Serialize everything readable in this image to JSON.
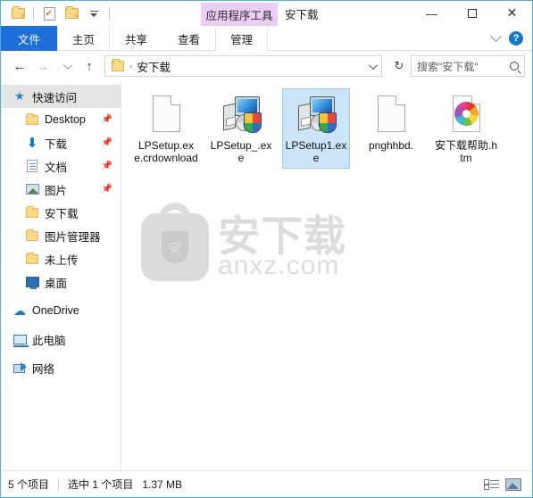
{
  "window": {
    "title": "安下载",
    "apptools_tab": "应用程序工具",
    "minimize": "—",
    "maximize": "",
    "close": "✕"
  },
  "quick_access_toolbar": {
    "items": [
      {
        "name": "folder-icon",
        "label": ""
      },
      {
        "name": "properties-icon",
        "label": ""
      },
      {
        "name": "new-folder-icon",
        "label": ""
      },
      {
        "name": "customize-dropdown-icon",
        "label": ""
      }
    ]
  },
  "ribbon": {
    "tabs": [
      {
        "label": "文件",
        "selected": true
      },
      {
        "label": "主页",
        "selected": false
      },
      {
        "label": "共享",
        "selected": false
      },
      {
        "label": "查看",
        "selected": false
      },
      {
        "label": "管理",
        "selected": false
      }
    ],
    "minimize_ribbon": "",
    "help": "?"
  },
  "address_bar": {
    "back": "←",
    "forward": "→",
    "recent": "",
    "up": "↑",
    "breadcrumb": [
      {
        "label": "安下载"
      }
    ],
    "separator": "›",
    "refresh": "↻",
    "search": {
      "placeholder": "搜索\"安下载\"",
      "value": ""
    }
  },
  "sidebar": {
    "items": [
      {
        "label": "快速访问",
        "icon": "star-icon",
        "selected": true,
        "indent": 0,
        "pinned": false
      },
      {
        "label": "Desktop",
        "icon": "folder-icon",
        "selected": false,
        "indent": 1,
        "pinned": true
      },
      {
        "label": "下载",
        "icon": "download-icon",
        "selected": false,
        "indent": 1,
        "pinned": true
      },
      {
        "label": "文档",
        "icon": "document-icon",
        "selected": false,
        "indent": 1,
        "pinned": true
      },
      {
        "label": "图片",
        "icon": "picture-icon",
        "selected": false,
        "indent": 1,
        "pinned": true
      },
      {
        "label": "安下载",
        "icon": "folder-icon",
        "selected": false,
        "indent": 1,
        "pinned": false
      },
      {
        "label": "图片管理器",
        "icon": "folder-icon",
        "selected": false,
        "indent": 1,
        "pinned": false
      },
      {
        "label": "未上传",
        "icon": "folder-icon",
        "selected": false,
        "indent": 1,
        "pinned": false
      },
      {
        "label": "桌面",
        "icon": "desktop-icon",
        "selected": false,
        "indent": 1,
        "pinned": false
      },
      {
        "label": "OneDrive",
        "icon": "onedrive-icon",
        "selected": false,
        "indent": 0,
        "pinned": false
      },
      {
        "label": "此电脑",
        "icon": "this-pc-icon",
        "selected": false,
        "indent": 0,
        "pinned": false
      },
      {
        "label": "网络",
        "icon": "network-icon",
        "selected": false,
        "indent": 0,
        "pinned": false
      }
    ],
    "pin_glyph": "📌"
  },
  "files": [
    {
      "name": "LPSetup.exe.crdownload",
      "icon": "blank-file-icon",
      "selected": false
    },
    {
      "name": "LPSetup_.exe",
      "icon": "setup-exe-icon",
      "selected": false
    },
    {
      "name": "LPSetup1.exe",
      "icon": "setup-exe-icon",
      "selected": true
    },
    {
      "name": "pnghhbd.",
      "icon": "blank-file-icon",
      "selected": false
    },
    {
      "name": "安下载帮助.htm",
      "icon": "html-pinwheel-icon",
      "selected": false
    }
  ],
  "watermark": {
    "cn_text": "安下载",
    "en_text": "anxz.com",
    "shield_glyph": "安"
  },
  "status_bar": {
    "item_count": "5 个项目",
    "selection": "选中 1 个项目",
    "size": "1.37 MB",
    "view_details": "",
    "view_large_icons": ""
  },
  "colors": {
    "accent": "#1e6fd9",
    "window_border": "#4bb3dd",
    "apptools_tab": "#eccdf5",
    "selection": "#cce4f7",
    "selection_border": "#99c9ef"
  }
}
